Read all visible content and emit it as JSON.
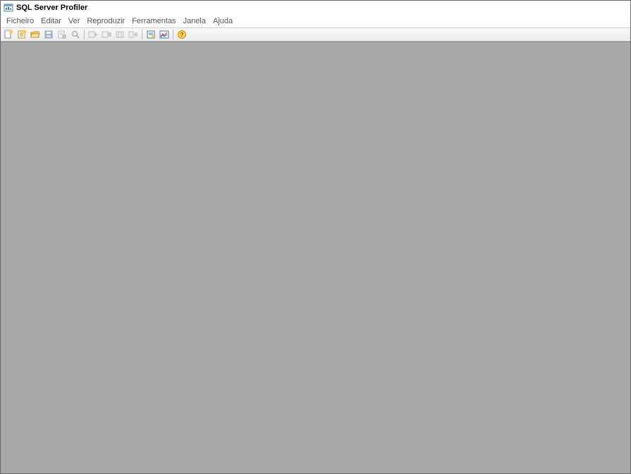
{
  "titlebar": {
    "title": "SQL Server Profiler"
  },
  "menu": {
    "items": [
      {
        "label": "Ficheiro"
      },
      {
        "label": "Editar"
      },
      {
        "label": "Ver"
      },
      {
        "label": "Reproduzir"
      },
      {
        "label": "Ferramentas"
      },
      {
        "label": "Janela"
      },
      {
        "label": "Ajuda"
      }
    ]
  },
  "toolbar": {
    "icons": {
      "new_trace": "new-trace-icon",
      "new_template": "new-template-icon",
      "open": "open-icon",
      "save": "save-icon",
      "properties": "properties-icon",
      "find": "find-icon",
      "run": "run-icon",
      "pause": "pause-icon",
      "stop": "stop-icon",
      "step": "step-icon",
      "autoscroll": "autoscroll-icon",
      "chart": "chart-icon",
      "help": "help-icon"
    }
  }
}
